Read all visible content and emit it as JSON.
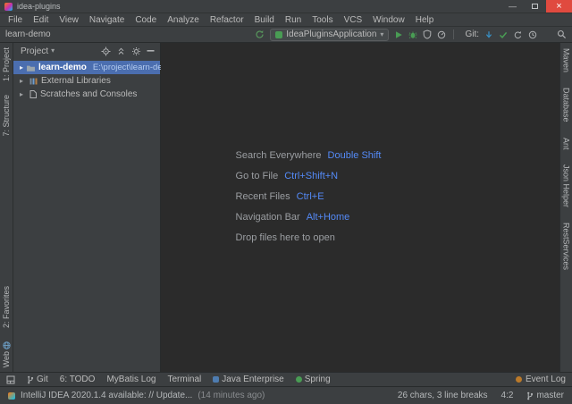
{
  "window": {
    "title": "idea-plugins"
  },
  "icons": {
    "minimize": "—",
    "close": "×",
    "chevron_down": "▾",
    "tree_arrow": "▸"
  },
  "menu": {
    "items": [
      "File",
      "Edit",
      "View",
      "Navigate",
      "Code",
      "Analyze",
      "Refactor",
      "Build",
      "Run",
      "Tools",
      "VCS",
      "Window",
      "Help"
    ]
  },
  "toolbar": {
    "breadcrumb": "learn-demo",
    "run_config": "IdeaPluginsApplication",
    "git_label": "Git:"
  },
  "left_strip": {
    "items_top": [
      {
        "label": "1: Project"
      },
      {
        "label": "7: Structure"
      }
    ],
    "items_bottom": [
      {
        "label": "2: Favorites"
      },
      {
        "label": "Web"
      }
    ]
  },
  "right_strip": {
    "items": [
      {
        "label": "Maven"
      },
      {
        "label": "Database"
      },
      {
        "label": "Ant"
      },
      {
        "label": "Json Helper"
      },
      {
        "label": "RestServices"
      }
    ]
  },
  "project_panel": {
    "title": "Project",
    "tree": [
      {
        "name": "learn-demo",
        "path": "E:\\project\\learn-demo"
      },
      {
        "name": "External Libraries",
        "path": ""
      },
      {
        "name": "Scratches and Consoles",
        "path": ""
      }
    ]
  },
  "editor": {
    "hints": [
      {
        "label": "Search Everywhere",
        "shortcut": "Double Shift"
      },
      {
        "label": "Go to File",
        "shortcut": "Ctrl+Shift+N"
      },
      {
        "label": "Recent Files",
        "shortcut": "Ctrl+E"
      },
      {
        "label": "Navigation Bar",
        "shortcut": "Alt+Home"
      },
      {
        "label": "Drop files here to open",
        "shortcut": ""
      }
    ]
  },
  "bottom_bar": {
    "items": [
      {
        "label": "Git"
      },
      {
        "label": "6: TODO"
      },
      {
        "label": "MyBatis Log"
      },
      {
        "label": "Terminal"
      },
      {
        "label": "Java Enterprise"
      },
      {
        "label": "Spring"
      }
    ],
    "event_log": "Event Log"
  },
  "status_bar": {
    "message": "IntelliJ IDEA 2020.1.4 available: // Update...",
    "time": "(14 minutes ago)",
    "selection_info": "26 chars, 3 line breaks",
    "caret": "4:2",
    "branch": "master"
  },
  "colors": {
    "accent_blue": "#548af7",
    "selection_blue": "#4b6eaf",
    "run_green": "#499c54",
    "close_red": "#e04a3f",
    "panel_bg": "#3c3f41",
    "editor_bg": "#2b2b2b"
  }
}
